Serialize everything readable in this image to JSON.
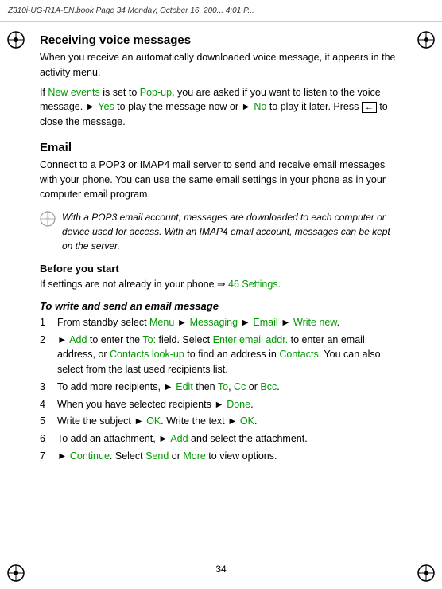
{
  "header": {
    "text": "Z310i-UG-R1A-EN.book  Page 34  Monday, October 16, 200...  4:01 P..."
  },
  "page_number": "34",
  "sections": {
    "voice_messages": {
      "heading": "Receiving voice messages",
      "para1": "When you receive an automatically downloaded voice message, it appears in the activity menu.",
      "para2_parts": [
        "If ",
        "New events",
        " is set to ",
        "Pop-up",
        ", you are asked if you want to listen to the voice message. ► ",
        "Yes",
        " to play the message now or ► ",
        "No",
        " to play it later. Press ",
        "⊕",
        " to close the message."
      ]
    },
    "email": {
      "heading": "Email",
      "para1": "Connect to a POP3 or IMAP4 mail server to send and receive email messages with your phone. You can use the same email settings in your phone as in your computer email program.",
      "tip": {
        "text": "With a POP3 email account, messages are downloaded to each computer or device used for access. With an IMAP4 email account, messages can be kept on the server."
      }
    },
    "before_you_start": {
      "heading": "Before you start",
      "text_parts": [
        "If settings are not already in your phone ⇒ ",
        "46 Settings",
        "."
      ]
    },
    "how_to": {
      "heading": "To write and send an email message",
      "steps": [
        {
          "num": "1",
          "text_parts": [
            "From standby select ",
            "Menu",
            " ► ",
            "Messaging",
            " ► ",
            "Email",
            " ► ",
            "Write new",
            "."
          ]
        },
        {
          "num": "2",
          "text_parts": [
            "► ",
            "Add",
            " to enter the ",
            "To:",
            " field. Select ",
            "Enter email addr.",
            " to enter an email address, or ",
            "Contacts look-up",
            " to find an address in ",
            "Contacts",
            ". You can also select from the last used recipients list."
          ]
        },
        {
          "num": "3",
          "text_parts": [
            "To add more recipients, ► ",
            "Edit",
            " then ",
            "To",
            ", ",
            "Cc",
            " or ",
            "Bcc",
            "."
          ]
        },
        {
          "num": "4",
          "text_parts": [
            "When you have selected recipients ► ",
            "Done",
            "."
          ]
        },
        {
          "num": "5",
          "text_parts": [
            "Write the subject ► ",
            "OK",
            ". Write the text ► ",
            "OK",
            "."
          ]
        },
        {
          "num": "6",
          "text_parts": [
            "To add an attachment, ► ",
            "Add",
            " and select the attachment."
          ]
        },
        {
          "num": "7",
          "text_parts": [
            "► ",
            "Continue",
            ". Select ",
            "Send",
            " or ",
            "More",
            " to view options."
          ]
        }
      ]
    }
  }
}
